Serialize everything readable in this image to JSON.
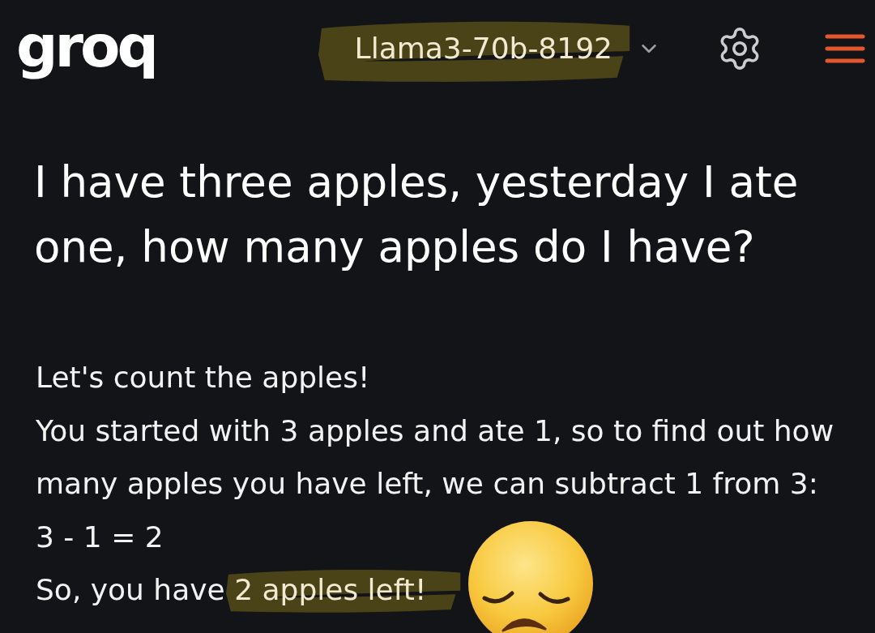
{
  "header": {
    "logo": "groq",
    "model_selector": {
      "label": "Llama3-70b-8192",
      "highlighted": true
    }
  },
  "question": "I have three apples, yesterday I ate one, how many apples do I have?",
  "answer": [
    {
      "segments": [
        {
          "text": "Let's count the apples!",
          "highlighted": false
        }
      ]
    },
    {
      "segments": [
        {
          "text": "You started with 3 apples and ate 1, so to find out how many apples you have left, we can subtract 1 from 3:",
          "highlighted": false
        }
      ]
    },
    {
      "segments": [
        {
          "text": "3 - 1 = 2",
          "highlighted": false
        }
      ]
    },
    {
      "segments": [
        {
          "text": "So, you have",
          "highlighted": false
        },
        {
          "text": "2 apples left!",
          "highlighted": true
        }
      ]
    }
  ]
}
